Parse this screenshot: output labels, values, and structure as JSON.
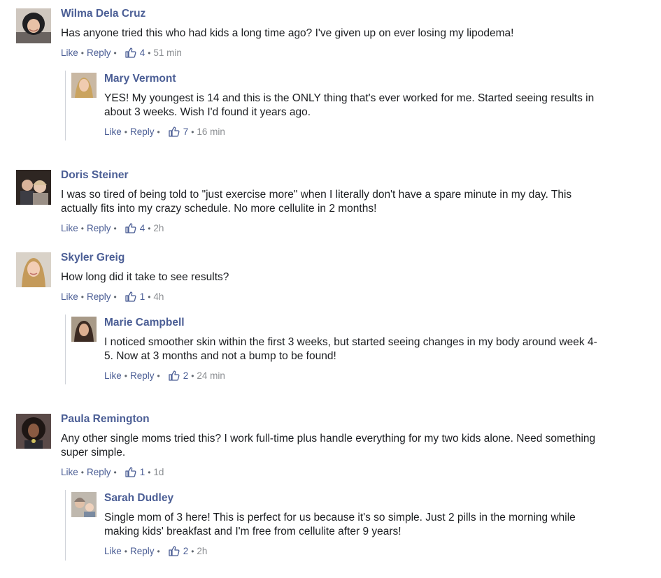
{
  "labels": {
    "like": "Like",
    "reply": "Reply"
  },
  "colors": {
    "name": "#4b5e95",
    "text": "#1c1e21",
    "meta": "#8a8d91"
  },
  "comments": [
    {
      "name": "Wilma Dela Cruz",
      "text": "Has anyone tried this who had kids a long time ago? I've given up on ever losing my lipodema!",
      "likes": "4",
      "time": "51 min",
      "avatar": "woman-headscarf",
      "reply": {
        "name": "Mary Vermont",
        "text": "YES! My youngest is 14 and this is the ONLY thing that's ever worked for me. Started seeing results in about 3 weeks. Wish I'd found it years ago.",
        "likes": "7",
        "time": "16 min",
        "avatar": "woman-blonde"
      }
    },
    {
      "name": "Doris Steiner",
      "text": "I was so tired of being told to \"just exercise more\" when I literally don't have a spare minute in my day. This actually fits into my crazy schedule. No more cellulite in 2 months!",
      "likes": "4",
      "time": "2h",
      "avatar": "couple-photo"
    },
    {
      "name": "Skyler Greig",
      "text": "How long did it take to see results?",
      "likes": "1",
      "time": "4h",
      "avatar": "woman-blonde-long",
      "reply": {
        "name": "Marie Campbell",
        "text": "I noticed smoother skin within the first 3 weeks, but started seeing changes in my body around week 4-5. Now at 3 months and not a bump to be found!",
        "likes": "2",
        "time": "24 min",
        "avatar": "woman-dark-hair"
      }
    },
    {
      "name": "Paula Remington",
      "text": "Any other single moms tried this? I work full-time plus handle everything for my two kids alone. Need something super simple.",
      "likes": "1",
      "time": "1d",
      "avatar": "woman-curly-hair",
      "reply": {
        "name": "Sarah Dudley",
        "text": "Single mom of 3 here! This is perfect for us because it's so simple. Just 2 pills in the morning while making kids' breakfast and I'm free from cellulite after 9 years!",
        "likes": "2",
        "time": "2h",
        "avatar": "woman-with-child"
      }
    }
  ]
}
